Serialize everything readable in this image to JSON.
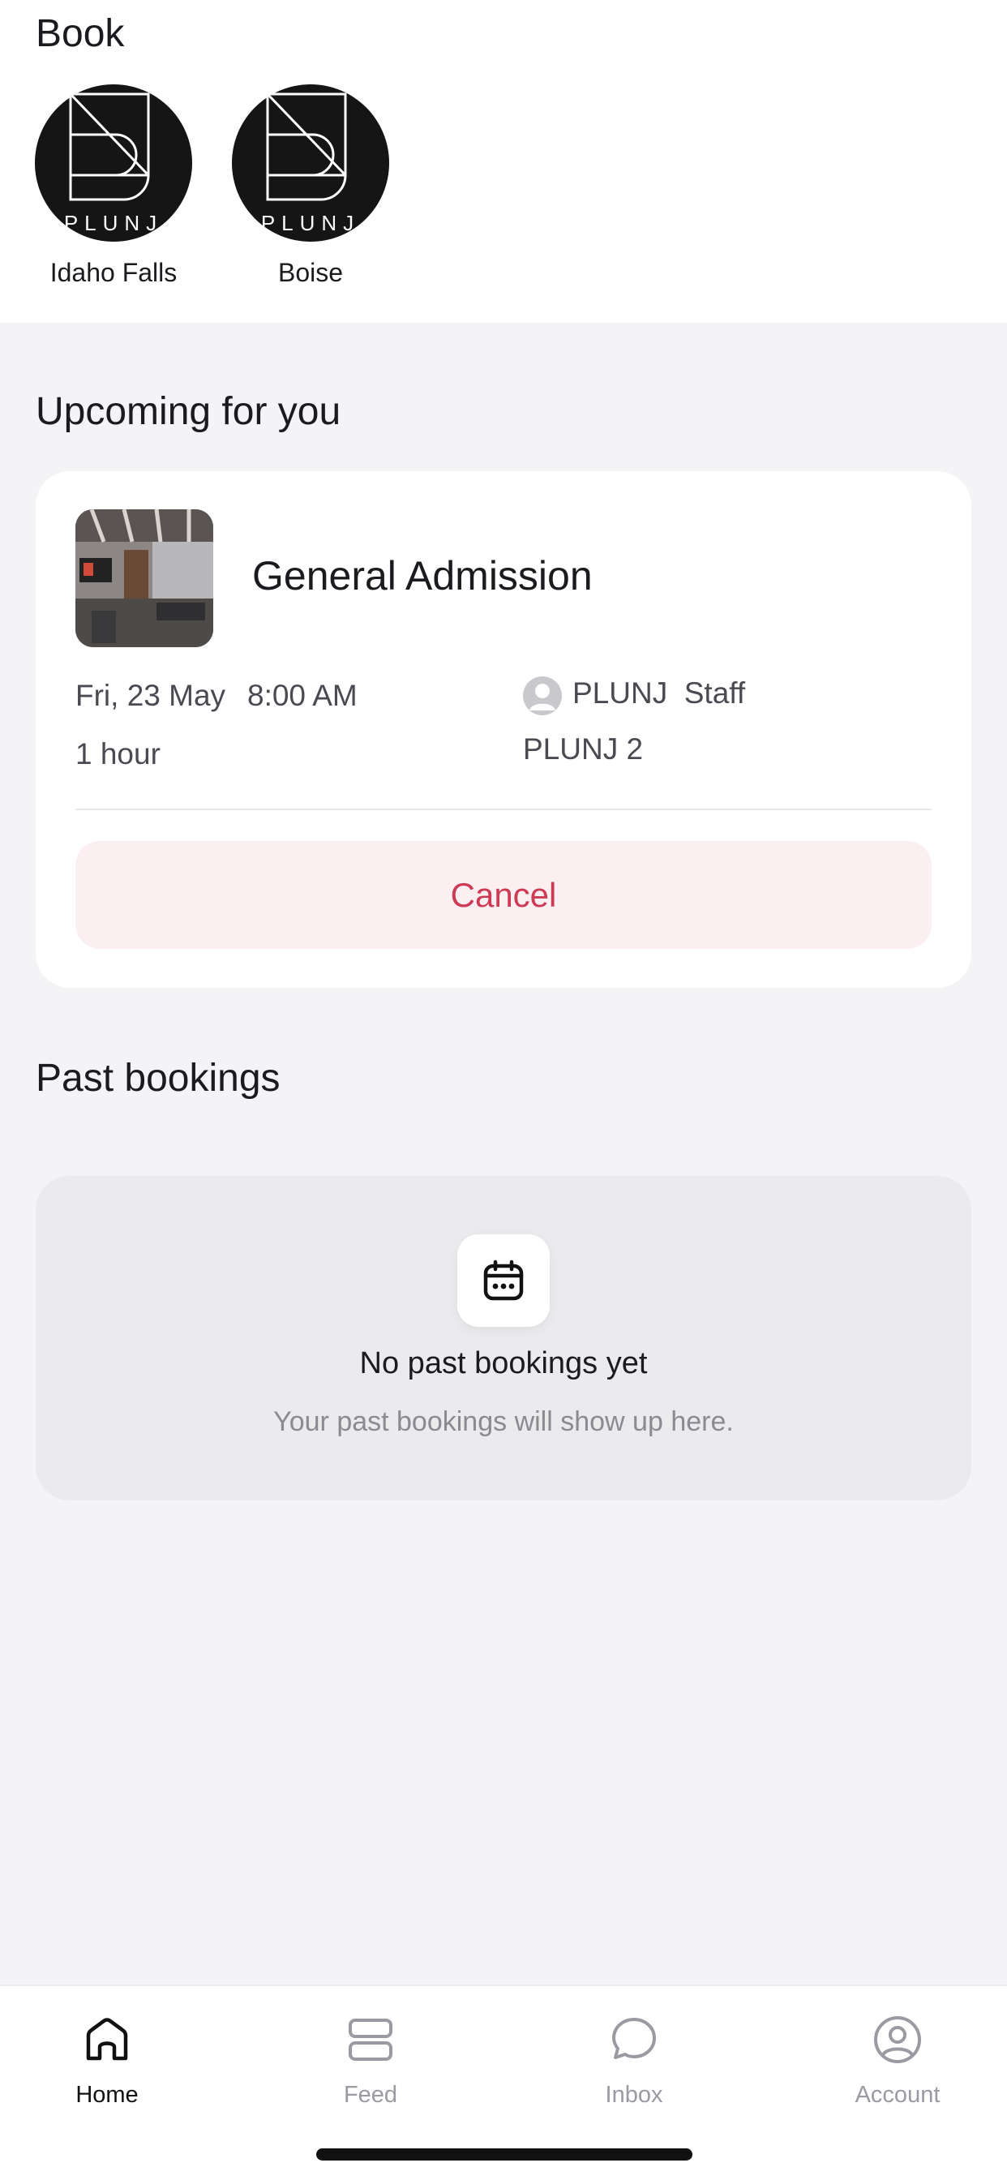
{
  "book": {
    "title": "Book",
    "locations": [
      {
        "label": "Idaho Falls",
        "logo_text": "PLUNJ"
      },
      {
        "label": "Boise",
        "logo_text": "PLUNJ"
      }
    ]
  },
  "upcoming": {
    "title": "Upcoming for you",
    "booking": {
      "name": "General Admission",
      "date": "Fri, 23 May",
      "time": "8:00 AM",
      "duration": "1 hour",
      "staff": "PLUNJ  Staff",
      "room": "PLUNJ 2",
      "cancel_label": "Cancel"
    }
  },
  "past": {
    "title": "Past bookings",
    "empty_title": "No past bookings yet",
    "empty_subtitle": "Your past bookings will show up here."
  },
  "tabs": [
    {
      "label": "Home",
      "icon": "home-icon",
      "active": true
    },
    {
      "label": "Feed",
      "icon": "feed-icon",
      "active": false
    },
    {
      "label": "Inbox",
      "icon": "inbox-icon",
      "active": false
    },
    {
      "label": "Account",
      "icon": "account-icon",
      "active": false
    }
  ],
  "colors": {
    "cancel_text": "#cd3a54",
    "cancel_bg": "#fbeff1",
    "page_bg": "#f4f4f6",
    "logo_bg": "#151515"
  }
}
